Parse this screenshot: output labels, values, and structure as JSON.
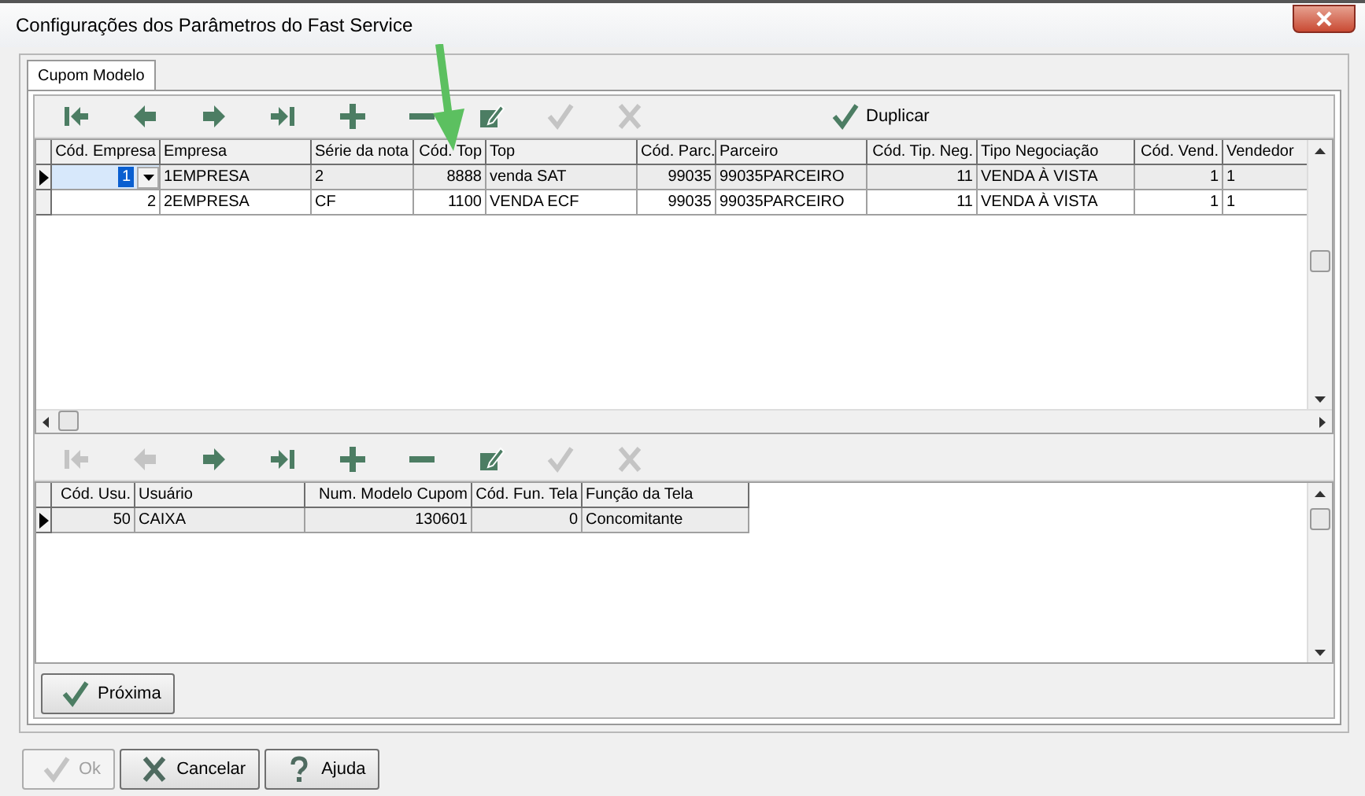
{
  "window": {
    "title": "Configurações dos Parâmetros do Fast Service"
  },
  "tabs": [
    {
      "label": "Cupom Modelo",
      "selected": true
    }
  ],
  "top_toolbar": {
    "buttons": [
      {
        "kind": "first",
        "disabled": false
      },
      {
        "kind": "prior",
        "disabled": false
      },
      {
        "kind": "next",
        "disabled": false
      },
      {
        "kind": "last",
        "disabled": false
      },
      {
        "kind": "insert",
        "disabled": false
      },
      {
        "kind": "delete",
        "disabled": false
      },
      {
        "kind": "edit",
        "disabled": false
      },
      {
        "kind": "post",
        "disabled": true
      },
      {
        "kind": "cancel",
        "disabled": true
      }
    ],
    "duplicate_button": {
      "label": "Duplicar"
    }
  },
  "top_grid": {
    "columns": [
      {
        "label": "Cód. Empresa",
        "kind": "number"
      },
      {
        "label": "Empresa",
        "kind": "text"
      },
      {
        "label": "Série da nota",
        "kind": "text"
      },
      {
        "label": "Cód. Top",
        "kind": "number"
      },
      {
        "label": "Top",
        "kind": "text"
      },
      {
        "label": "Cód. Parc.",
        "kind": "number"
      },
      {
        "label": "Parceiro",
        "kind": "text"
      },
      {
        "label": "Cód. Tip. Neg.",
        "kind": "number"
      },
      {
        "label": "Tipo Negociação",
        "kind": "text"
      },
      {
        "label": "Cód. Vend.",
        "kind": "number"
      },
      {
        "label": "Vendedor",
        "kind": "text"
      }
    ],
    "rows": [
      {
        "selected": true,
        "cells": [
          "1",
          "1EMPRESA",
          "2",
          "8888",
          "venda SAT",
          "99035",
          "99035PARCEIRO",
          "11",
          "VENDA À VISTA",
          "1",
          "1"
        ]
      },
      {
        "selected": false,
        "cells": [
          "2",
          "2EMPRESA",
          "CF",
          "1100",
          "VENDA ECF",
          "99035",
          "99035PARCEIRO",
          "11",
          "VENDA À VISTA",
          "1",
          "1"
        ]
      }
    ]
  },
  "bottom_toolbar": {
    "buttons": [
      {
        "kind": "first",
        "disabled": true
      },
      {
        "kind": "prior",
        "disabled": true
      },
      {
        "kind": "next",
        "disabled": false
      },
      {
        "kind": "last",
        "disabled": false
      },
      {
        "kind": "insert",
        "disabled": false
      },
      {
        "kind": "delete",
        "disabled": false
      },
      {
        "kind": "edit",
        "disabled": false
      },
      {
        "kind": "post",
        "disabled": true
      },
      {
        "kind": "cancel",
        "disabled": true
      }
    ]
  },
  "bottom_grid": {
    "columns": [
      {
        "label": "Cód. Usu.",
        "kind": "number"
      },
      {
        "label": "Usuário",
        "kind": "text"
      },
      {
        "label": "Num. Modelo Cupom",
        "kind": "number"
      },
      {
        "label": "Cód. Fun. Tela",
        "kind": "number"
      },
      {
        "label": "Função da Tela",
        "kind": "text"
      }
    ],
    "rows": [
      {
        "selected": true,
        "cells": [
          "50",
          "CAIXA",
          "130601",
          "0",
          "Concomitante"
        ]
      }
    ]
  },
  "next_button": {
    "label": "Próxima"
  },
  "dialog_buttons": [
    {
      "kind": "ok",
      "label": "Ok",
      "disabled": true
    },
    {
      "kind": "cancel",
      "label": "Cancelar",
      "disabled": false
    },
    {
      "kind": "help",
      "label": "Ajuda",
      "disabled": false
    }
  ]
}
